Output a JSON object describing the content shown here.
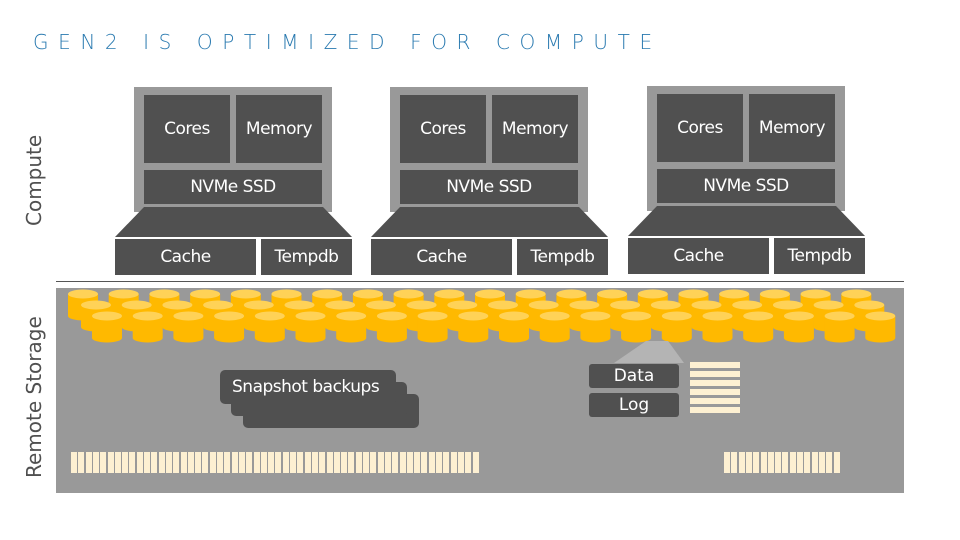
{
  "title": "GEN2 IS OPTIMIZED FOR COMPUTE",
  "axis_labels": {
    "compute": "Compute",
    "remote_storage": "Remote Storage"
  },
  "colors": {
    "title": "#2a7ab0",
    "frame": "#999999",
    "block": "#505050",
    "cylinder_body": "#ffb900",
    "cylinder_top": "#ffd257",
    "stripe": "#fdf0d2",
    "storage_panel": "#999999"
  },
  "compute_nodes": [
    {
      "cores": "Cores",
      "memory": "Memory",
      "nvme": "NVMe SSD",
      "cache": "Cache",
      "tempdb": "Tempdb"
    },
    {
      "cores": "Cores",
      "memory": "Memory",
      "nvme": "NVMe SSD",
      "cache": "Cache",
      "tempdb": "Tempdb"
    },
    {
      "cores": "Cores",
      "memory": "Memory",
      "nvme": "NVMe SSD",
      "cache": "Cache",
      "tempdb": "Tempdb"
    }
  ],
  "storage": {
    "disk_rows": 3,
    "disks_per_row": 20,
    "snapshot_label": "Snapshot backups",
    "data_label": "Data",
    "log_label": "Log",
    "log_stripes": 6,
    "tape_left_count": 56,
    "tape_right_count": 16
  }
}
